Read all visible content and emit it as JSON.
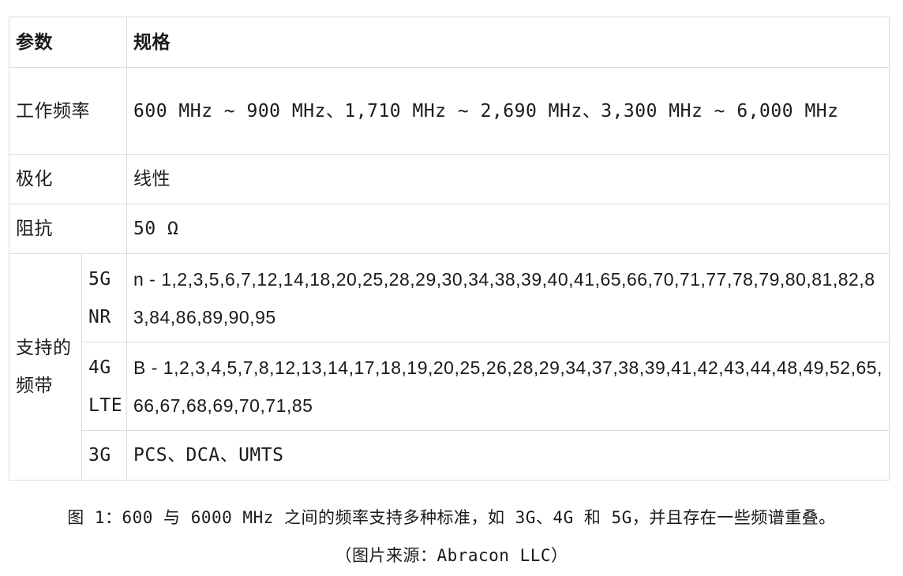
{
  "table": {
    "header": {
      "param": "参数",
      "spec": "规格"
    },
    "rows": [
      {
        "param": "工作频率",
        "value": "600 MHz ~ 900 MHz、1,710 MHz ~  2,690 MHz、3,300 MHz ~ 6,000 MHz"
      },
      {
        "param": "极化",
        "value": "线性"
      },
      {
        "param": "阻抗",
        "value": "50 Ω"
      }
    ],
    "supported_bands": {
      "label": "支持的频带",
      "entries": [
        {
          "tech": "5G NR",
          "value": "n - 1,2,3,5,6,7,12,14,18,20,25,28,29,30,34,38,39,40,41,65,66,70,71,77,78,79,80,81,82,83,84,86,89,90,95"
        },
        {
          "tech": "4G LTE",
          "value": "B - 1,2,3,4,5,7,8,12,13,14,17,18,19,20,25,26,28,29,34,37,38,39,41,42,43,44,48,49,52,65,66,67,68,69,70,71,85"
        },
        {
          "tech": "3G",
          "value": "PCS、DCA、UMTS"
        }
      ]
    }
  },
  "caption": {
    "main": "图 1：600 与 6000 MHz 之间的频率支持多种标准，如 3G、4G 和 5G，并且存在一些频谱重叠。",
    "source": "（图片来源：Abracon LLC）"
  }
}
